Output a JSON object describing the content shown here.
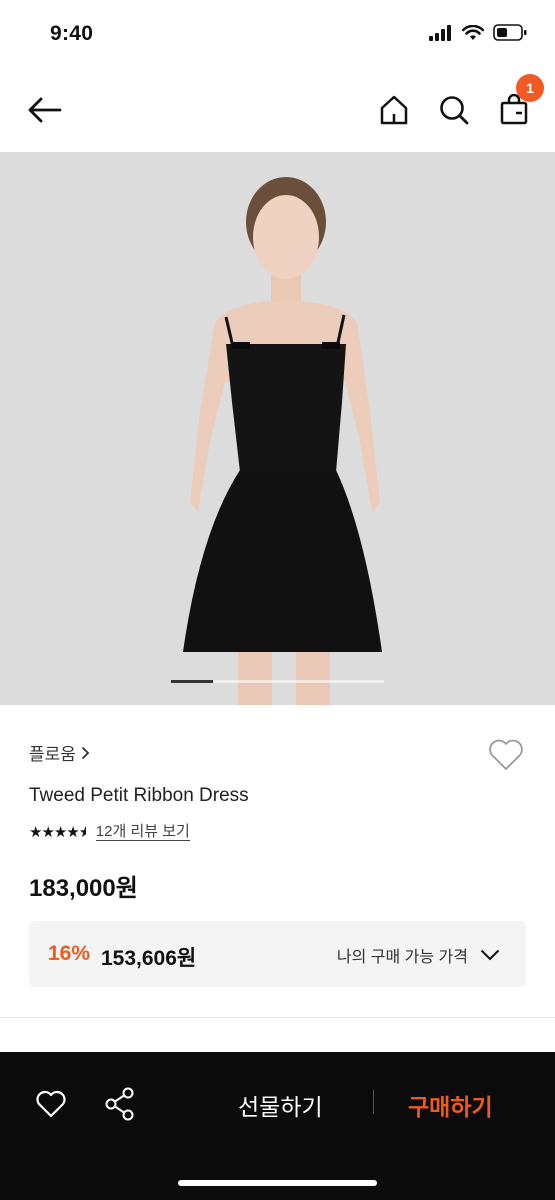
{
  "status_bar": {
    "time": "9:40"
  },
  "nav": {
    "back_icon": "arrow-left-icon",
    "home_icon": "home-icon",
    "search_icon": "search-icon",
    "cart_icon": "shopping-bag-icon",
    "cart_count": "1"
  },
  "hero": {
    "image_alt": "black tweed mini dress",
    "slide_index": 1
  },
  "product": {
    "brand": "플로움",
    "name": "Tweed Petit Ribbon Dress",
    "rating": 4.5,
    "review_link": "12개 리뷰 보기",
    "price": "183,000원",
    "discount_rate": "16%",
    "discount_price": "153,606원",
    "my_price_label": "나의 구매 가능 가격"
  },
  "bottom_bar": {
    "gift_label": "선물하기",
    "buy_label": "구매하기"
  },
  "colors": {
    "accent": "#ef5a1f",
    "badge": "#f15a24",
    "bottom_bar": "#0b0b0b"
  }
}
